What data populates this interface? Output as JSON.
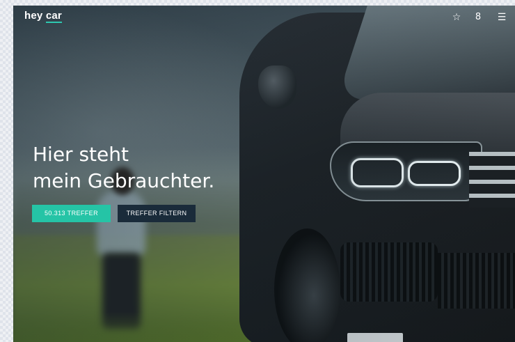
{
  "header": {
    "logo_part1": "hey",
    "logo_part2": "car",
    "icons": [
      "star-icon",
      "user-icon",
      "menu-icon"
    ],
    "star_glyph": "☆",
    "user_glyph": "8",
    "menu_glyph": "☰"
  },
  "hero": {
    "headline_line1": "Hier steht",
    "headline_line2": "mein Gebrauchter.",
    "results_button": "50.313 TREFFER",
    "filter_button": "TREFFER FILTERN"
  },
  "colors": {
    "accent": "#25c4a6",
    "dark_button": "#1a2b3a",
    "text": "#ffffff"
  }
}
